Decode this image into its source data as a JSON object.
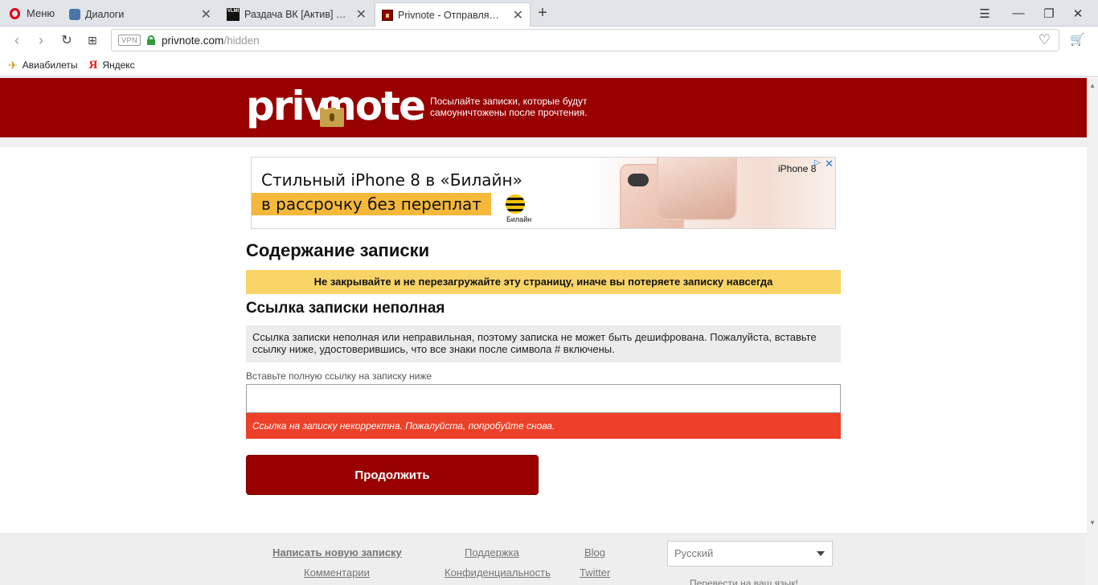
{
  "browser": {
    "menu_label": "Меню",
    "tabs": [
      {
        "title": "Диалоги"
      },
      {
        "title": "Раздача ВК [Актив] от Нат",
        "favicon_text": "VLMI"
      },
      {
        "title": "Privnote - Отправляйте за"
      }
    ],
    "url_host": "privnote.com",
    "url_path": "/hidden",
    "vpn_badge": "VPN",
    "bookmarks": [
      {
        "label": "Авиабилеты"
      },
      {
        "label": "Яндекс",
        "icon_text": "Я"
      }
    ]
  },
  "header": {
    "logo_text": "privnote",
    "tagline": "Посылайте записки, которые будут самоуничтожены после прочтения.",
    "background": "#990000"
  },
  "ad": {
    "line1": "Стильный iPhone 8 в «Билайн»",
    "line2": "в рассрочку без переплат",
    "beeline_label": "Билайн",
    "brand": "iPhone 8"
  },
  "main": {
    "title": "Содержание записки",
    "warning": "Не закрывайте и не перезагружайте эту страницу, иначе вы потеряете записку навсегда",
    "subtitle": "Ссылка записки неполная",
    "info_text": "Ссылка записки неполная или неправильная, поэтому записка не может быть дешифрована. Пожалуйста, вставьте ссылку ниже, удостоверившись, что все знаки после символа # включены.",
    "input_label": "Вставьте полную ссылку на записку ниже",
    "input_value": "",
    "error_text": "Ссылка на записку некорректна. Пожалуйста, попробуйте снова.",
    "continue_label": "Продолжить",
    "colors": {
      "warning_bg": "#f8d466",
      "error_bg": "#ed4028",
      "button_bg": "#990000"
    }
  },
  "footer": {
    "links": [
      "Написать новую записку",
      "Поддержка",
      "Blog",
      "Комментарии",
      "Конфиденциальность",
      "Twitter"
    ],
    "language": "Русский",
    "translate_hint": "Перевести на ваш язык!"
  }
}
